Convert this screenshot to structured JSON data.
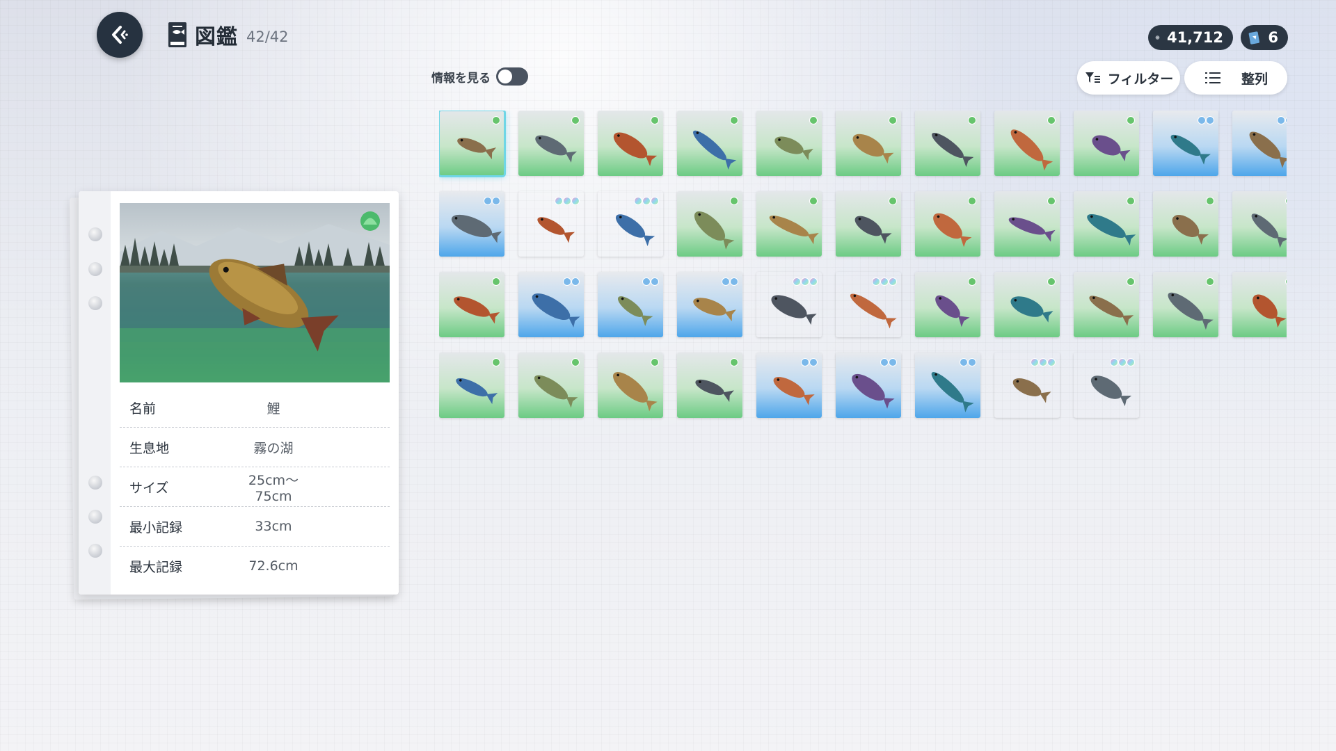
{
  "header": {
    "title": "図鑑",
    "count": "42/42"
  },
  "currency": {
    "coins": "41,712",
    "tickets": "6"
  },
  "toolbar": {
    "info_toggle_label": "情報を見る",
    "info_toggle_on": false,
    "filter_label": "フィルター",
    "sort_label": "整列"
  },
  "detail": {
    "rows": [
      {
        "label": "名前",
        "value": "鯉"
      },
      {
        "label": "生息地",
        "value": "霧の湖"
      },
      {
        "label": "サイズ",
        "value": "25cm～75cm"
      },
      {
        "label": "最小記録",
        "value": "33cm"
      },
      {
        "label": "最大記録",
        "value": "72.6cm"
      }
    ]
  },
  "colors": {
    "selected_outline": "#6fd6e6",
    "common": "#6ccb84",
    "rare": "#4ea6ea",
    "legendary": "#f2b8e0",
    "dark_ui": "#263240"
  },
  "fish_tiles": [
    {
      "rarity": "common",
      "icon": "carp-icon",
      "selected": true
    },
    {
      "rarity": "common",
      "icon": "brown-fish-icon"
    },
    {
      "rarity": "common",
      "icon": "small-fish-icon"
    },
    {
      "rarity": "common",
      "icon": "catfish-icon"
    },
    {
      "rarity": "common",
      "icon": "pike-icon"
    },
    {
      "rarity": "common",
      "icon": "dark-fish-icon"
    },
    {
      "rarity": "common",
      "icon": "bluegill-icon"
    },
    {
      "rarity": "common",
      "icon": "bass-icon"
    },
    {
      "rarity": "common",
      "icon": "trout-icon"
    },
    {
      "rarity": "rare",
      "icon": "spotted-fish-icon"
    },
    {
      "rarity": "rare",
      "icon": "gar-icon"
    },
    {
      "rarity": "rare",
      "icon": "arowana-icon"
    },
    {
      "rarity": "legendary",
      "icon": "mermaid-icon"
    },
    {
      "rarity": "legendary",
      "icon": "big-fish-icon"
    },
    {
      "rarity": "common",
      "icon": "mackerel-icon"
    },
    {
      "rarity": "common",
      "icon": "seahorse-icon"
    },
    {
      "rarity": "common",
      "icon": "clownfish-icon"
    },
    {
      "rarity": "common",
      "icon": "blue-tang-icon"
    },
    {
      "rarity": "common",
      "icon": "tuna-icon"
    },
    {
      "rarity": "common",
      "icon": "sea-dragon-icon"
    },
    {
      "rarity": "common",
      "icon": "striped-fish-icon"
    },
    {
      "rarity": "common",
      "icon": "pufferfish-icon"
    },
    {
      "rarity": "common",
      "icon": "shark-icon"
    },
    {
      "rarity": "rare",
      "icon": "sea-turtle-icon"
    },
    {
      "rarity": "rare",
      "icon": "wrasse-icon"
    },
    {
      "rarity": "rare",
      "icon": "coelacanth-icon"
    },
    {
      "rarity": "legendary",
      "icon": "dragon-icon"
    },
    {
      "rarity": "legendary",
      "icon": "crab-monster-icon"
    },
    {
      "rarity": "common",
      "icon": "sardine-icon"
    },
    {
      "rarity": "common",
      "icon": "silver-fish-icon"
    },
    {
      "rarity": "common",
      "icon": "grouper-icon"
    },
    {
      "rarity": "common",
      "icon": "red-fish-icon"
    },
    {
      "rarity": "common",
      "icon": "starfish-icon"
    },
    {
      "rarity": "common",
      "icon": "salmon-icon"
    },
    {
      "rarity": "common",
      "icon": "cod-icon"
    },
    {
      "rarity": "common",
      "icon": "blue-fish-icon"
    },
    {
      "rarity": "common",
      "icon": "char-icon"
    },
    {
      "rarity": "rare",
      "icon": "eel-icon"
    },
    {
      "rarity": "rare",
      "icon": "tiny-fish-icon"
    },
    {
      "rarity": "rare",
      "icon": "king-crab-icon"
    },
    {
      "rarity": "legendary",
      "icon": "blue-mermaid-icon"
    },
    {
      "rarity": "legendary",
      "icon": "golden-salmon-icon"
    }
  ]
}
